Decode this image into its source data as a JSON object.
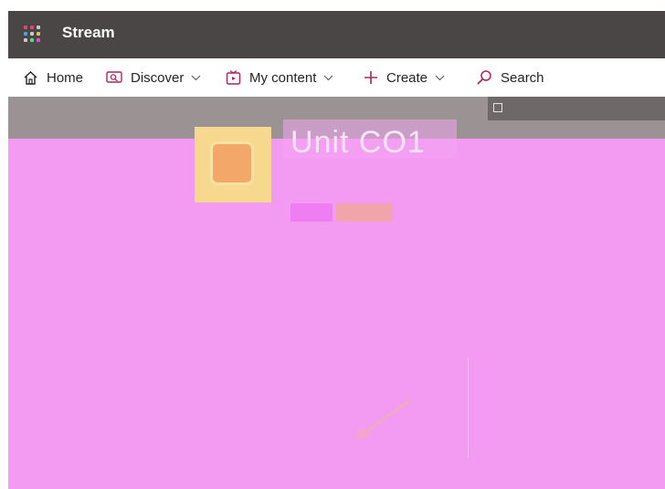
{
  "app": {
    "name": "Stream"
  },
  "nav": {
    "home": "Home",
    "discover": "Discover",
    "my_content": "My content",
    "create": "Create",
    "search": "Search"
  },
  "video": {
    "title": "Unit CO1",
    "tags": [
      "",
      ""
    ]
  },
  "icons": {
    "app_launcher": "waffle-icon",
    "home": "home-icon",
    "discover": "discover-icon",
    "my_content": "my-content-icon",
    "create": "plus-icon",
    "search": "search-icon"
  },
  "colors": {
    "header_bg": "#4a4646",
    "overlay_magenta": "#f39af3",
    "thumbnail": "#f6d98f",
    "waffle_dots": [
      "#e04a6a",
      "#e04a6a",
      "#c8c8c8",
      "#4aa3e0",
      "#c8c8c8",
      "#e0c04a",
      "#c8c8c8",
      "#4ae08a",
      "#e04ae0"
    ]
  }
}
